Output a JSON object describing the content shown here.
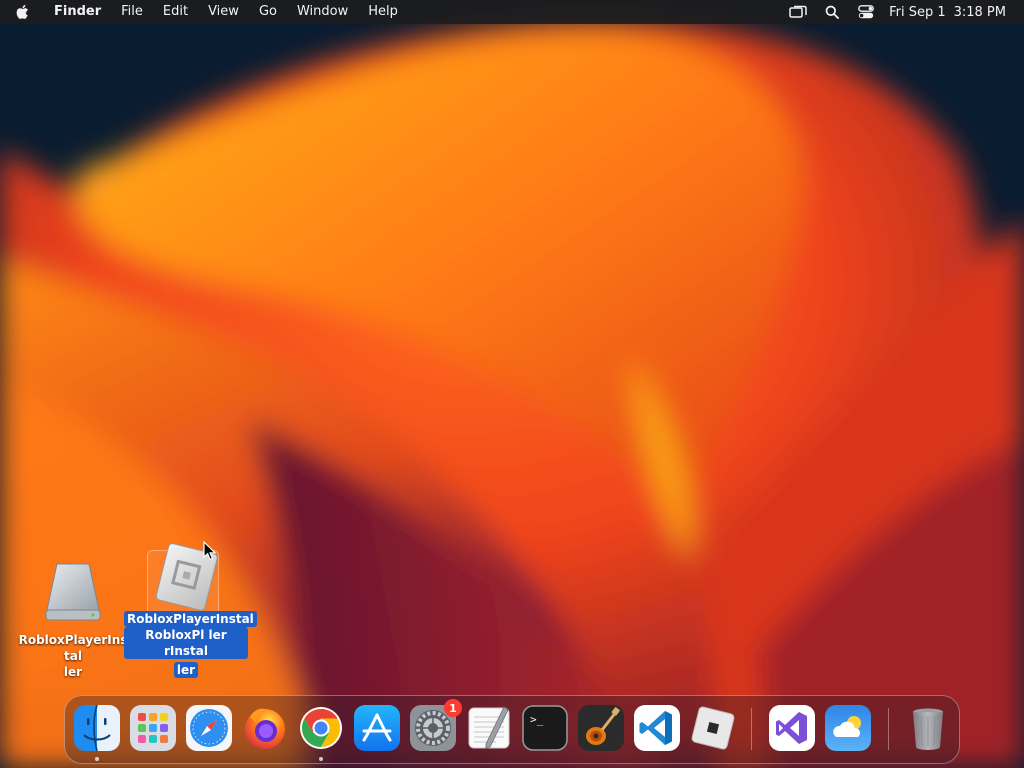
{
  "menubar": {
    "app_name": "Finder",
    "menus": [
      "File",
      "Edit",
      "View",
      "Go",
      "Window",
      "Help"
    ],
    "status_icons": [
      "screen-mirroring-icon",
      "spotlight-search-icon",
      "control-center-icon"
    ],
    "clock_date": "Fri Sep 1",
    "clock_time": "3:18 PM"
  },
  "desktop": {
    "drive_icon": {
      "label_line1": "RobloxPlayerInstal",
      "label_line2": "ler"
    },
    "roblox_icon": {
      "label_line1": "RobloxPlayerInstal",
      "label_line2": "RobloxPl ler rInstal",
      "label_line3": "ler"
    }
  },
  "dock": {
    "items": [
      {
        "name": "finder-icon",
        "running": true
      },
      {
        "name": "launchpad-icon",
        "running": false
      },
      {
        "name": "safari-icon",
        "running": false
      },
      {
        "name": "firefox-icon",
        "running": false
      },
      {
        "name": "chrome-icon",
        "running": true
      },
      {
        "name": "app-store-icon",
        "running": false
      },
      {
        "name": "system-settings-icon",
        "running": false,
        "badge": "1"
      },
      {
        "name": "textedit-icon",
        "running": false
      },
      {
        "name": "terminal-icon",
        "running": false
      },
      {
        "name": "garageband-icon",
        "running": false
      },
      {
        "name": "vscode-icon",
        "running": false
      },
      {
        "name": "roblox-icon",
        "running": false
      },
      {
        "name": "visual-studio-icon",
        "running": false
      },
      {
        "name": "weather-icon",
        "running": false
      },
      {
        "name": "trash-icon",
        "running": false
      }
    ],
    "terminal_prompt": ">_"
  },
  "colors": {
    "selection_blue": "#1f5fc8",
    "badge_red": "#ff3b30"
  }
}
